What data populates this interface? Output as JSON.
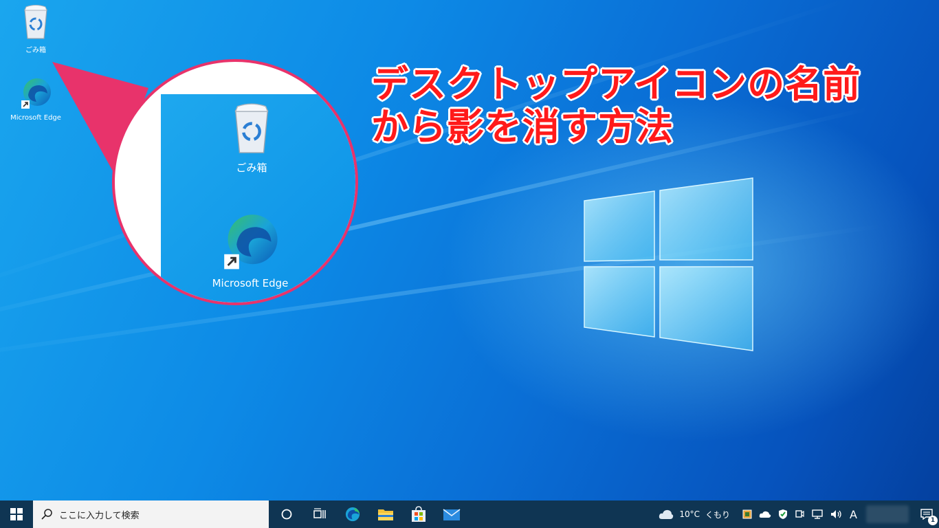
{
  "desktop": {
    "icons": [
      {
        "label": "ごみ箱",
        "icon": "recycle-bin-icon"
      },
      {
        "label": "Microsoft Edge",
        "icon": "edge-icon"
      }
    ]
  },
  "zoom": {
    "icons": [
      {
        "label": "ごみ箱",
        "icon": "recycle-bin-icon"
      },
      {
        "label": "Microsoft Edge",
        "icon": "edge-icon"
      }
    ],
    "border_color": "#e8336b"
  },
  "headline": {
    "line1": "デスクトップアイコンの名前",
    "line2": "から影を消す方法",
    "color": "#ff1a1a"
  },
  "taskbar": {
    "search_placeholder": "ここに入力して検索",
    "apps": [
      "cortana-icon",
      "task-view-icon",
      "edge-icon",
      "file-explorer-icon",
      "store-icon",
      "mail-icon"
    ],
    "weather": {
      "temp": "10°C",
      "condition": "くもり"
    },
    "ime": "A",
    "notification_count": "1"
  }
}
